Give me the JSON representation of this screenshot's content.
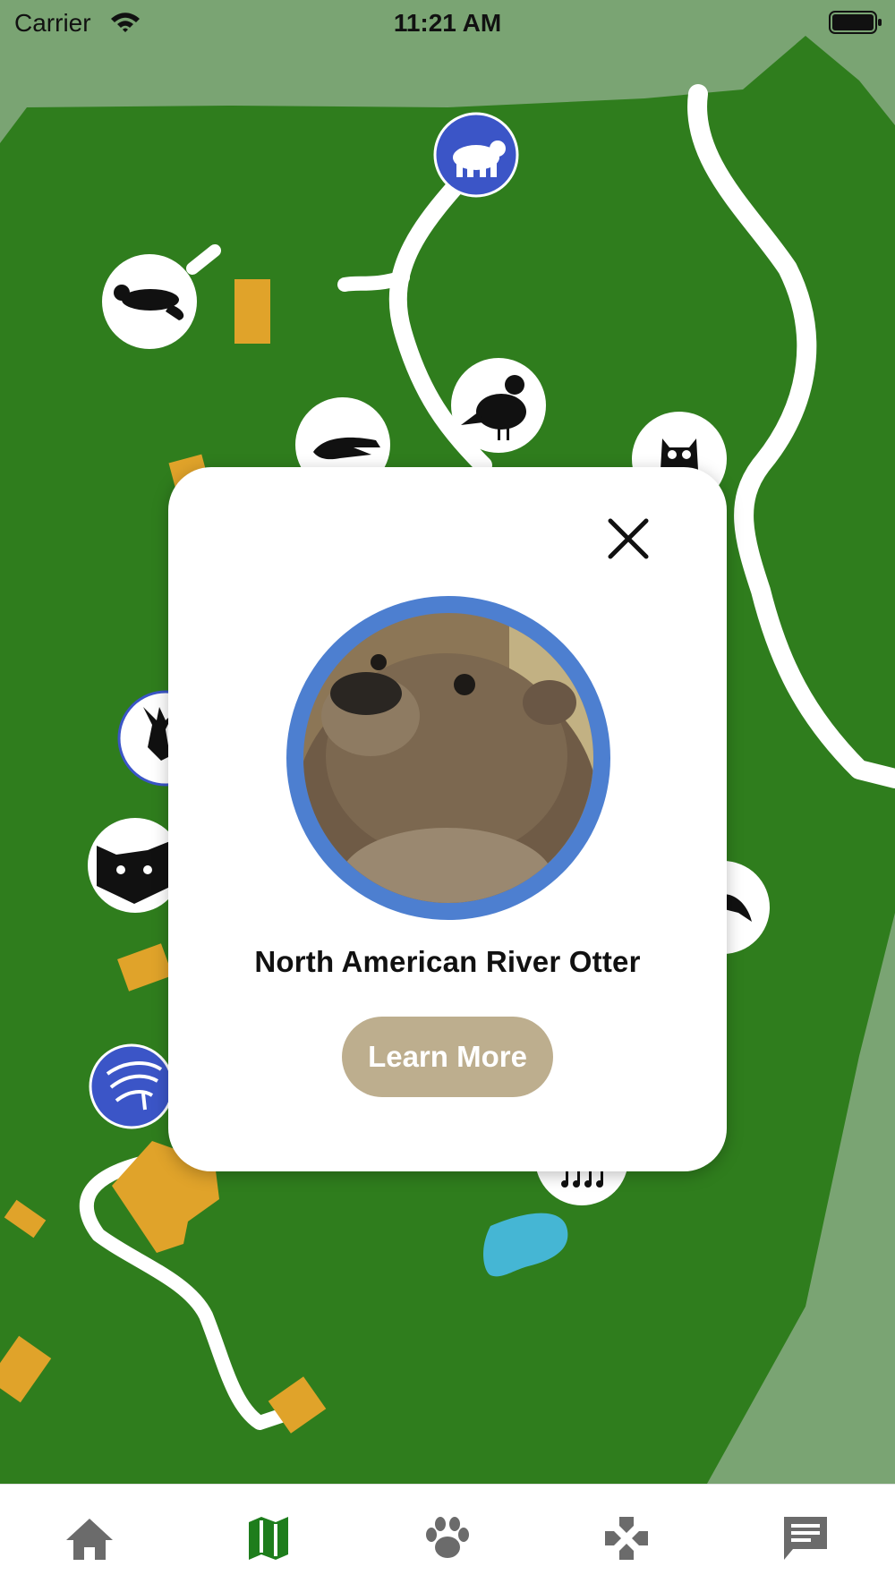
{
  "status_bar": {
    "carrier": "Carrier",
    "time": "11:21 AM"
  },
  "popup": {
    "animal_name": "North American River Otter",
    "learn_more_label": "Learn More",
    "photo_ring_color": "#4d7fd0",
    "button_color": "#bdae8e"
  },
  "map": {
    "grass_color": "#2f7d1d",
    "outer_color": "#7aa473",
    "path_color": "#ffffff",
    "building_color": "#e0a32a",
    "pond_color": "#45b6d4",
    "pins": [
      {
        "icon": "bear-icon",
        "style": "blue"
      },
      {
        "icon": "otter-icon",
        "style": "white"
      },
      {
        "icon": "quail-icon",
        "style": "white"
      },
      {
        "icon": "alligator-icon",
        "style": "white"
      },
      {
        "icon": "owl-icon",
        "style": "white"
      },
      {
        "icon": "elk-icon",
        "style": "white"
      },
      {
        "icon": "bobcat-icon",
        "style": "white"
      },
      {
        "icon": "bird-icon",
        "style": "white"
      },
      {
        "icon": "music-icon",
        "style": "white"
      },
      {
        "icon": "amphitheater-icon",
        "style": "blue"
      }
    ]
  },
  "tab_bar": {
    "active_color": "#1e7d1c",
    "inactive_color": "#6b6b6b",
    "tabs": [
      {
        "icon": "home-icon",
        "active": false
      },
      {
        "icon": "map-icon",
        "active": true
      },
      {
        "icon": "paw-icon",
        "active": false
      },
      {
        "icon": "gamepad-icon",
        "active": false
      },
      {
        "icon": "chat-icon",
        "active": false
      }
    ]
  }
}
